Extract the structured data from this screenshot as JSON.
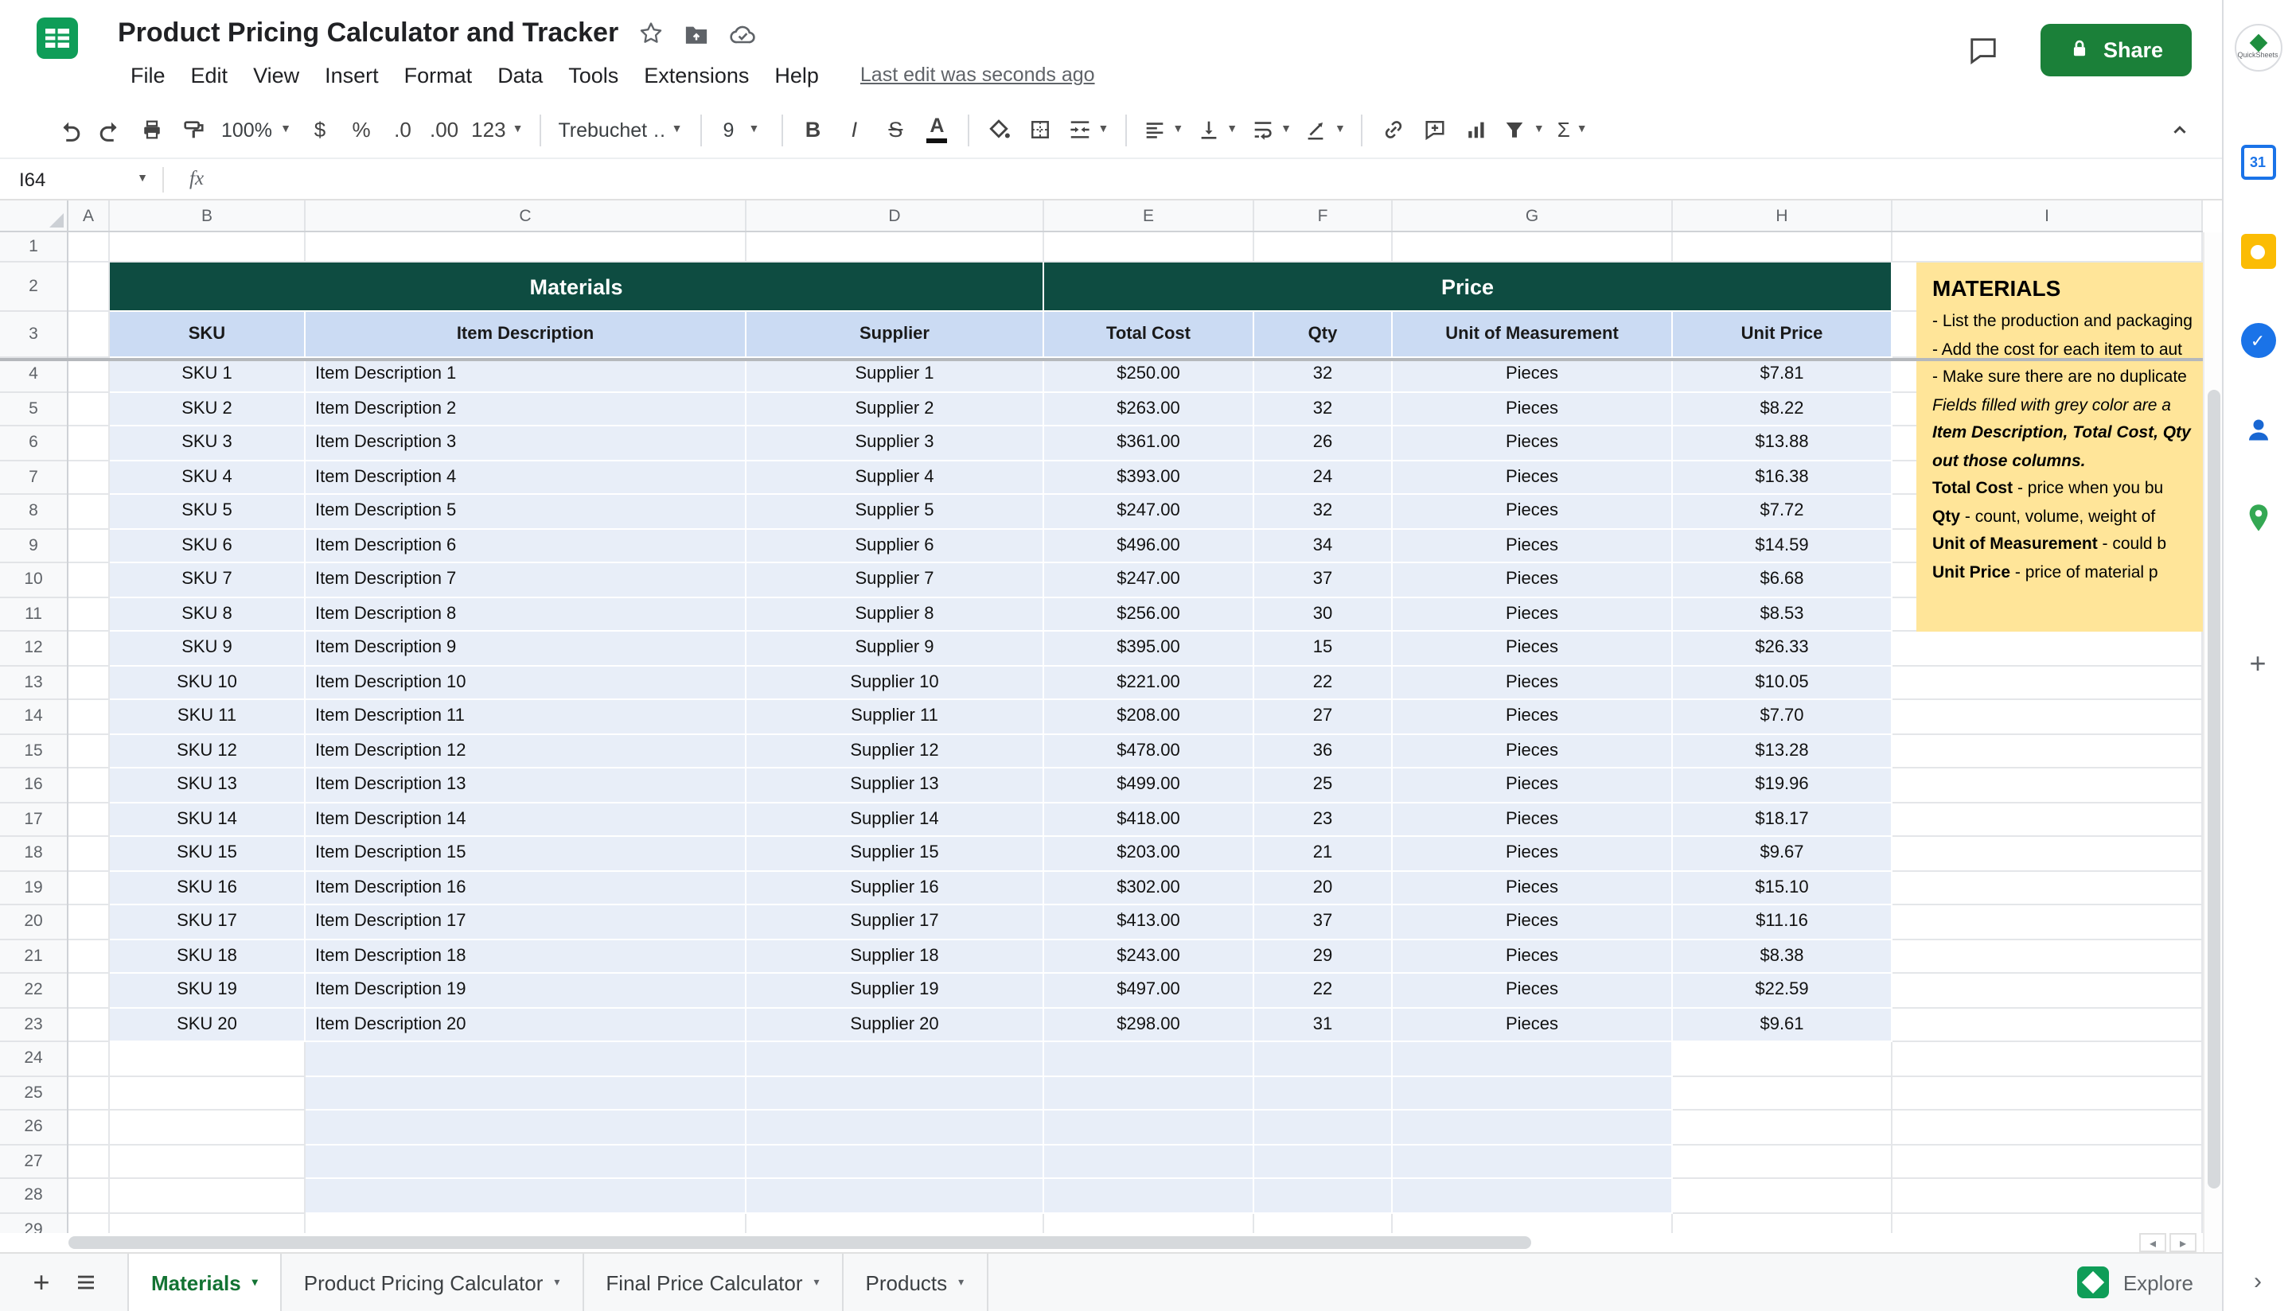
{
  "header": {
    "title": "Product Pricing Calculator and Tracker",
    "menus": [
      "File",
      "Edit",
      "View",
      "Insert",
      "Format",
      "Data",
      "Tools",
      "Extensions",
      "Help"
    ],
    "last_edit": "Last edit was seconds ago",
    "share_label": "Share",
    "avatar_label": "QuickSheets"
  },
  "toolbar": {
    "zoom": "100%",
    "currency": "$",
    "percent": "%",
    "decrease_decimal": ".0",
    "increase_decimal": ".00",
    "number_format": "123",
    "font_name": "Trebuchet …",
    "font_size": "9",
    "bold": "B",
    "italic": "I",
    "strikethrough": "S",
    "text_color": "A",
    "functions": "Σ"
  },
  "formula_bar": {
    "cell_ref": "I64",
    "fx_label": "fx",
    "value": ""
  },
  "sheet": {
    "column_letters": [
      "A",
      "B",
      "C",
      "D",
      "E",
      "F",
      "G",
      "H",
      "I"
    ],
    "banner": {
      "materials": "Materials",
      "price": "Price"
    },
    "column_headers": [
      "SKU",
      "Item Description",
      "Supplier",
      "Total Cost",
      "Qty",
      "Unit of Measurement",
      "Unit Price"
    ],
    "rows": [
      [
        "SKU 1",
        "Item Description 1",
        "Supplier 1",
        "$250.00",
        "32",
        "Pieces",
        "$7.81"
      ],
      [
        "SKU 2",
        "Item Description 2",
        "Supplier 2",
        "$263.00",
        "32",
        "Pieces",
        "$8.22"
      ],
      [
        "SKU 3",
        "Item Description 3",
        "Supplier 3",
        "$361.00",
        "26",
        "Pieces",
        "$13.88"
      ],
      [
        "SKU 4",
        "Item Description 4",
        "Supplier 4",
        "$393.00",
        "24",
        "Pieces",
        "$16.38"
      ],
      [
        "SKU 5",
        "Item Description 5",
        "Supplier 5",
        "$247.00",
        "32",
        "Pieces",
        "$7.72"
      ],
      [
        "SKU 6",
        "Item Description 6",
        "Supplier 6",
        "$496.00",
        "34",
        "Pieces",
        "$14.59"
      ],
      [
        "SKU 7",
        "Item Description 7",
        "Supplier 7",
        "$247.00",
        "37",
        "Pieces",
        "$6.68"
      ],
      [
        "SKU 8",
        "Item Description 8",
        "Supplier 8",
        "$256.00",
        "30",
        "Pieces",
        "$8.53"
      ],
      [
        "SKU 9",
        "Item Description 9",
        "Supplier 9",
        "$395.00",
        "15",
        "Pieces",
        "$26.33"
      ],
      [
        "SKU 10",
        "Item Description 10",
        "Supplier 10",
        "$221.00",
        "22",
        "Pieces",
        "$10.05"
      ],
      [
        "SKU 11",
        "Item Description 11",
        "Supplier 11",
        "$208.00",
        "27",
        "Pieces",
        "$7.70"
      ],
      [
        "SKU 12",
        "Item Description 12",
        "Supplier 12",
        "$478.00",
        "36",
        "Pieces",
        "$13.28"
      ],
      [
        "SKU 13",
        "Item Description 13",
        "Supplier 13",
        "$499.00",
        "25",
        "Pieces",
        "$19.96"
      ],
      [
        "SKU 14",
        "Item Description 14",
        "Supplier 14",
        "$418.00",
        "23",
        "Pieces",
        "$18.17"
      ],
      [
        "SKU 15",
        "Item Description 15",
        "Supplier 15",
        "$203.00",
        "21",
        "Pieces",
        "$9.67"
      ],
      [
        "SKU 16",
        "Item Description 16",
        "Supplier 16",
        "$302.00",
        "20",
        "Pieces",
        "$15.10"
      ],
      [
        "SKU 17",
        "Item Description 17",
        "Supplier 17",
        "$413.00",
        "37",
        "Pieces",
        "$11.16"
      ],
      [
        "SKU 18",
        "Item Description 18",
        "Supplier 18",
        "$243.00",
        "29",
        "Pieces",
        "$8.38"
      ],
      [
        "SKU 19",
        "Item Description 19",
        "Supplier 19",
        "$497.00",
        "22",
        "Pieces",
        "$22.59"
      ],
      [
        "SKU 20",
        "Item Description 20",
        "Supplier 20",
        "$298.00",
        "31",
        "Pieces",
        "$9.61"
      ]
    ],
    "visible_row_count": 29
  },
  "note": {
    "title": "MATERIALS",
    "lines": [
      {
        "r": "- List the production and packaging"
      },
      {
        "r": "- Add the cost for each item to aut"
      },
      {
        "r": "- Make sure there are no duplicate"
      },
      {
        "i": "Fields filled with grey color are a"
      },
      {
        "bi": "Item Description, Total Cost, Qty"
      },
      {
        "bi": "out those columns."
      },
      {
        "b": "Total Cost",
        "r": " - price when you bu"
      },
      {
        "b": "Qty",
        "r": " - count, volume, weight of"
      },
      {
        "b": "Unit of Measurement",
        "r": " - could b"
      },
      {
        "b": "Unit Price",
        "r": " - price of material p"
      }
    ]
  },
  "tabs": {
    "add_sheet": "+",
    "sheets": [
      {
        "label": "Materials",
        "active": true
      },
      {
        "label": "Product Pricing Calculator",
        "active": false
      },
      {
        "label": "Final Price Calculator",
        "active": false
      },
      {
        "label": "Products",
        "active": false
      }
    ],
    "explore_label": "Explore"
  },
  "side_panel": {
    "calendar_day": "31",
    "icons": [
      "calendar-icon",
      "keep-icon",
      "tasks-icon",
      "contacts-icon",
      "maps-icon",
      "add-addon-icon"
    ]
  },
  "colors": {
    "banner_green": "#0e4c41",
    "header_blue": "#cbdbf3",
    "data_blue": "#e8eef8",
    "note_yellow": "#ffe599",
    "share_green": "#1b8039",
    "active_tab_green": "#137333",
    "logo_green": "#0f9d58"
  }
}
